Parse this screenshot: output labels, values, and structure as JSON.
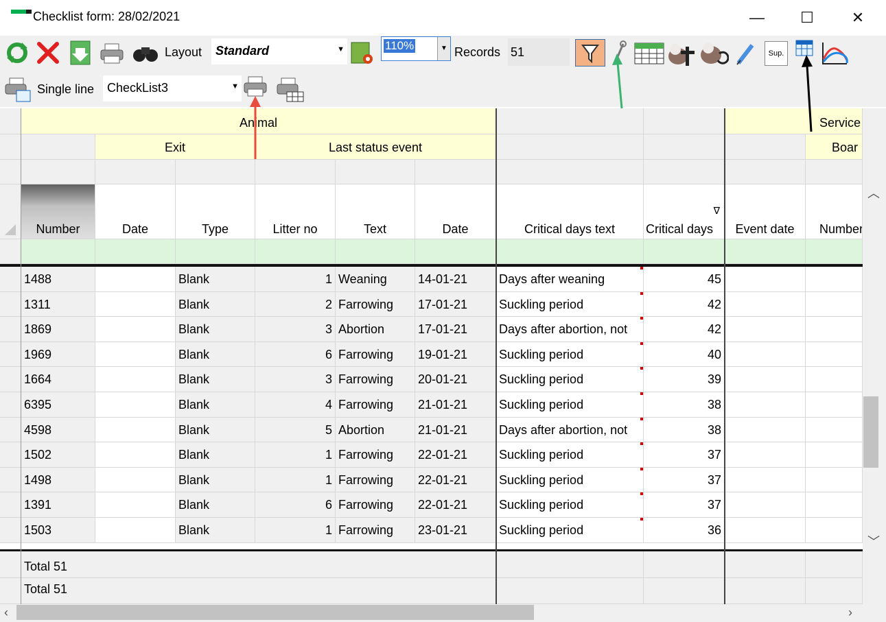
{
  "window": {
    "title": "Checklist form: 28/02/2021",
    "minimize": "—",
    "maximize": "☐",
    "close": "✕"
  },
  "toolbar": {
    "layout_label": "Layout",
    "layout_value": "Standard",
    "zoom_value": "110%",
    "records_label": "Records",
    "records_value": "51",
    "single_line_label": "Single line",
    "single_line_value": "CheckList3",
    "sup_label": "Sup."
  },
  "grid": {
    "group_animal": "Animal",
    "group_service": "Service",
    "sub_exit": "Exit",
    "sub_last_status": "Last status event",
    "sub_boar": "Boar",
    "columns": [
      "Number",
      "Date",
      "Type",
      "Litter no",
      "Text",
      "Date",
      "Critical days text",
      "Critical days",
      "Event date",
      "Number"
    ],
    "sort_indicator": "∇",
    "rows": [
      [
        "1488",
        "",
        "Blank",
        "1",
        "Weaning",
        "14-01-21",
        "Days after weaning",
        "45",
        "",
        ""
      ],
      [
        "1311",
        "",
        "Blank",
        "2",
        "Farrowing",
        "17-01-21",
        "Suckling period",
        "42",
        "",
        ""
      ],
      [
        "1869",
        "",
        "Blank",
        "3",
        "Abortion",
        "17-01-21",
        "Days after abortion, not",
        "42",
        "",
        ""
      ],
      [
        "1969",
        "",
        "Blank",
        "6",
        "Farrowing",
        "19-01-21",
        "Suckling period",
        "40",
        "",
        ""
      ],
      [
        "1664",
        "",
        "Blank",
        "3",
        "Farrowing",
        "20-01-21",
        "Suckling period",
        "39",
        "",
        ""
      ],
      [
        "6395",
        "",
        "Blank",
        "4",
        "Farrowing",
        "21-01-21",
        "Suckling period",
        "38",
        "",
        ""
      ],
      [
        "4598",
        "",
        "Blank",
        "5",
        "Abortion",
        "21-01-21",
        "Days after abortion, not",
        "38",
        "",
        ""
      ],
      [
        "1502",
        "",
        "Blank",
        "1",
        "Farrowing",
        "22-01-21",
        "Suckling period",
        "37",
        "",
        ""
      ],
      [
        "1498",
        "",
        "Blank",
        "1",
        "Farrowing",
        "22-01-21",
        "Suckling period",
        "37",
        "",
        ""
      ],
      [
        "1391",
        "",
        "Blank",
        "6",
        "Farrowing",
        "22-01-21",
        "Suckling period",
        "37",
        "",
        ""
      ],
      [
        "1503",
        "",
        "Blank",
        "1",
        "Farrowing",
        "23-01-21",
        "Suckling period",
        "36",
        "",
        ""
      ]
    ],
    "totals": [
      "Total 51",
      "Total 51"
    ]
  },
  "colors": {
    "header_yellow": "#ffffd6",
    "filter_row_green": "#dcf5dc",
    "filter_button": "#f4b183",
    "annotation_red": "#e74c3c",
    "annotation_green": "#3cb371",
    "annotation_black": "#000000"
  }
}
